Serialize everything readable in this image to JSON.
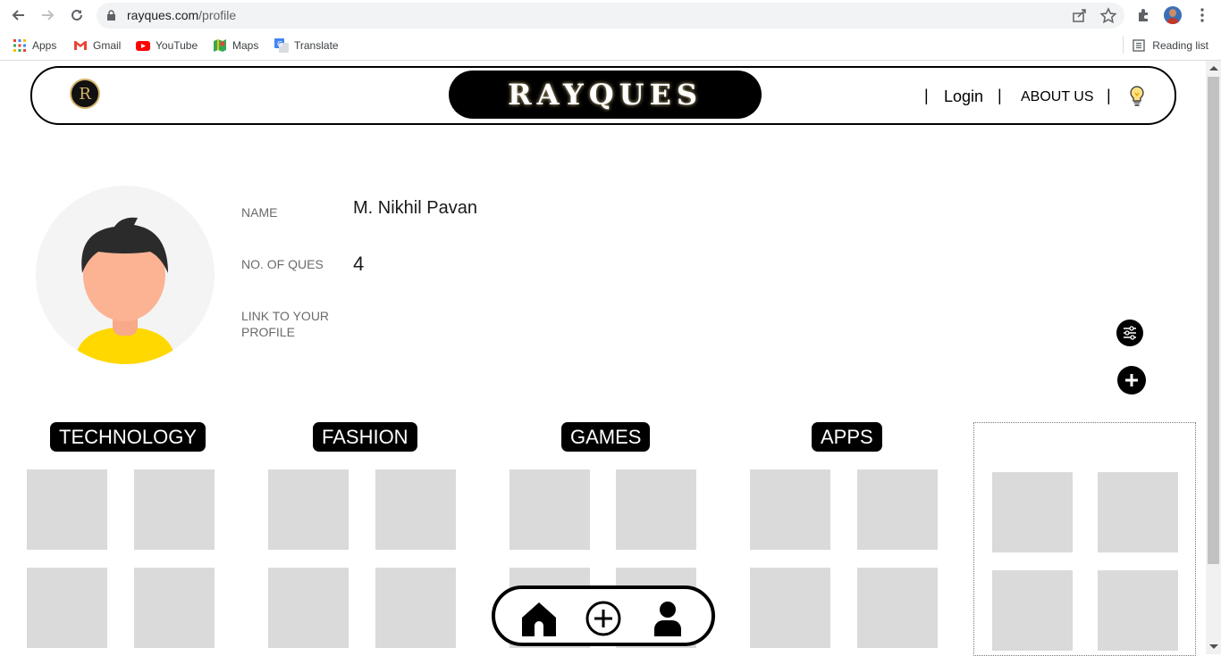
{
  "browser": {
    "url_host": "rayques.com",
    "url_path": "/profile",
    "bookmarks": [
      {
        "label": "Apps",
        "icon": "apps-grid-icon"
      },
      {
        "label": "Gmail",
        "icon": "gmail-icon"
      },
      {
        "label": "YouTube",
        "icon": "youtube-icon"
      },
      {
        "label": "Maps",
        "icon": "maps-icon"
      },
      {
        "label": "Translate",
        "icon": "translate-icon"
      }
    ],
    "reading_list": "Reading list"
  },
  "header": {
    "logo_letter": "R",
    "brand": "RAYQUES",
    "login": "Login",
    "about": "ABOUT US",
    "separator": "|"
  },
  "profile": {
    "name_label": "NAME",
    "name_value": "M. Nikhil Pavan",
    "ques_label": "NO. OF QUES",
    "ques_value": "4",
    "link_label": "LINK TO YOUR PROFILE"
  },
  "categories": [
    "TECHNOLOGY",
    "FASHION",
    "GAMES",
    "APPS"
  ],
  "colors": {
    "accent": "#000000",
    "tile": "#dadada",
    "shirt": "#ffd800",
    "skin": "#fbb393",
    "hair": "#2b2b2b"
  }
}
